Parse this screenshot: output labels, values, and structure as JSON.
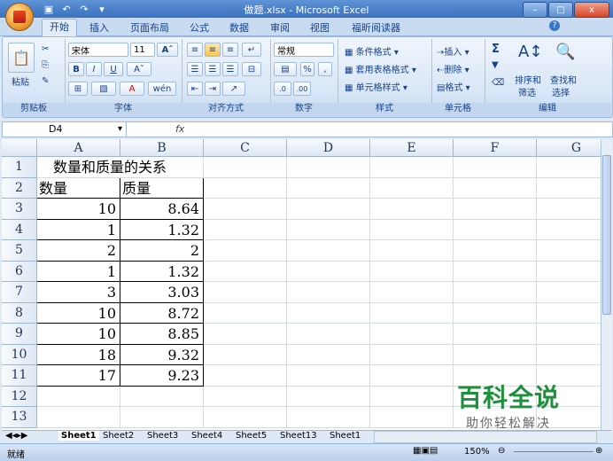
{
  "window": {
    "title": "做题.xlsx - Microsoft Excel",
    "min": "–",
    "max": "□",
    "close": "x"
  },
  "qat": {
    "save": "▣",
    "undo": "↶",
    "redo": "↷",
    "customize": "▾"
  },
  "tabs": [
    {
      "label": "开始",
      "active": true
    },
    {
      "label": "插入"
    },
    {
      "label": "页面布局"
    },
    {
      "label": "公式"
    },
    {
      "label": "数据"
    },
    {
      "label": "审阅"
    },
    {
      "label": "视图"
    },
    {
      "label": "福昕阅读器"
    }
  ],
  "help_icon": "?",
  "ribbon": {
    "clipboard": {
      "label": "剪贴板",
      "paste": "粘贴"
    },
    "font": {
      "label": "字体",
      "font_name": "宋体",
      "font_size": "11",
      "bold": "B",
      "italic": "I",
      "underline": "U",
      "grow": "Aˆ",
      "shrink": "Aˇ",
      "wen": "wén"
    },
    "alignment": {
      "label": "对齐方式"
    },
    "number": {
      "label": "数字",
      "format": "常规",
      "percent": "%",
      "comma": ","
    },
    "styles": {
      "label": "样式",
      "conditional": "条件格式",
      "table": "套用表格格式",
      "cell": "单元格样式"
    },
    "cells": {
      "label": "单元格",
      "insert": "插入",
      "delete": "删除",
      "format": "格式"
    },
    "editing": {
      "label": "编辑",
      "sort": "排序和",
      "filter": "筛选",
      "find": "查找和",
      "select": "选择",
      "sigma": "Σ"
    }
  },
  "formula_bar": {
    "name_box": "D4",
    "fx": "fx"
  },
  "columns": [
    "A",
    "B",
    "C",
    "D",
    "E",
    "F",
    "G"
  ],
  "rows": [
    "1",
    "2",
    "3",
    "4",
    "5",
    "6",
    "7",
    "8",
    "9",
    "10",
    "11",
    "12",
    "13"
  ],
  "sheet": {
    "title": "数量和质量的关系",
    "header_a": "数量",
    "header_b": "质量",
    "data": [
      {
        "a": "10",
        "b": "8.64"
      },
      {
        "a": "1",
        "b": "1.32"
      },
      {
        "a": "2",
        "b": "2"
      },
      {
        "a": "1",
        "b": "1.32"
      },
      {
        "a": "3",
        "b": "3.03"
      },
      {
        "a": "10",
        "b": "8.72"
      },
      {
        "a": "10",
        "b": "8.85"
      },
      {
        "a": "18",
        "b": "9.32"
      },
      {
        "a": "17",
        "b": "9.23"
      }
    ]
  },
  "sheet_tabs": [
    "Sheet1",
    "Sheet2",
    "Sheet3",
    "Sheet4",
    "Sheet5",
    "Sheet13",
    "Sheet1"
  ],
  "status": {
    "ready": "就绪",
    "zoom": "150%"
  },
  "watermark": {
    "line1": "百科全说",
    "line2": "助你轻松解决"
  }
}
